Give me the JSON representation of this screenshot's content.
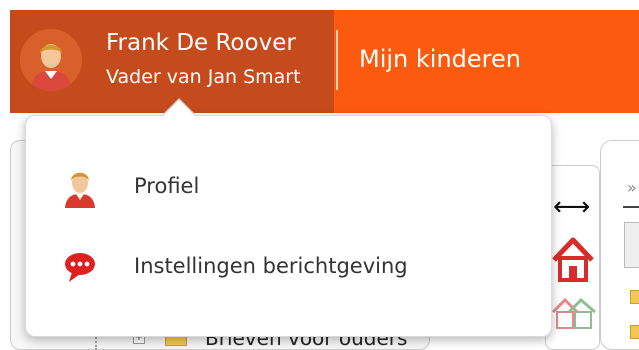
{
  "header": {
    "user_name": "Frank De Roover",
    "user_role": "Vader van Jan Smart",
    "nav_link": "Mijn kinderen",
    "colors": {
      "user_block": "#c54b1c",
      "nav_block": "#fb5a0f"
    }
  },
  "dropdown": {
    "items": [
      {
        "label": "Profiel",
        "icon": "user-icon"
      },
      {
        "label": "Instellingen berichtgeving",
        "icon": "speech-bubble-icon"
      }
    ]
  },
  "background": {
    "tree_item_label": "Brieven voor ouders",
    "tree_toggle": "+",
    "right_chevrons": "»"
  }
}
